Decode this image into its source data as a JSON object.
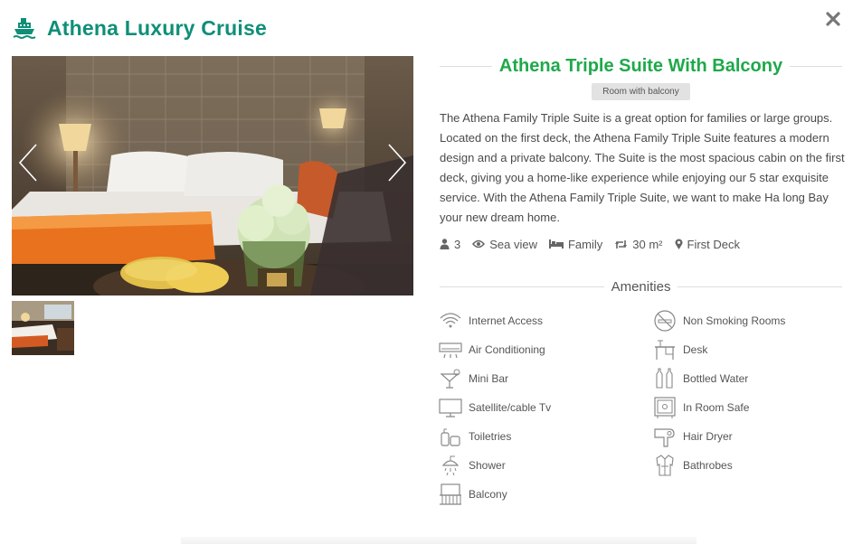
{
  "header": {
    "title": "Athena Luxury Cruise",
    "icon": "ship-icon",
    "accent": "#0f8f78"
  },
  "close": {
    "icon": "close-icon"
  },
  "gallery": {
    "prev_icon": "chevron-left-icon",
    "next_icon": "chevron-right-icon"
  },
  "room": {
    "title": "Athena Triple Suite With Balcony",
    "title_color": "#1ea94a",
    "tag": "Room with balcony",
    "description": "The Athena Family Triple Suite is a great option for families or large groups.  Located on the first deck, the Athena Family Triple Suite features a modern design and a private balcony.  The Suite is the most spacious cabin on the first deck, giving you a home-like experience while enjoying our 5 star exquisite service. With the Athena Family Triple Suite, we want to make Ha long Bay your new dream home.",
    "meta": {
      "guests": "3",
      "view": "Sea view",
      "bed": "Family",
      "size": "30 m²",
      "location": "First Deck"
    }
  },
  "amenities": {
    "title": "Amenities",
    "left": [
      "Internet Access",
      "Air Conditioning",
      "Mini Bar",
      "Satellite/cable Tv",
      "Toiletries",
      "Shower",
      "Balcony"
    ],
    "right": [
      "Non Smoking Rooms",
      "Desk",
      "Bottled Water",
      "In Room Safe",
      "Hair Dryer",
      "Bathrobes"
    ]
  }
}
